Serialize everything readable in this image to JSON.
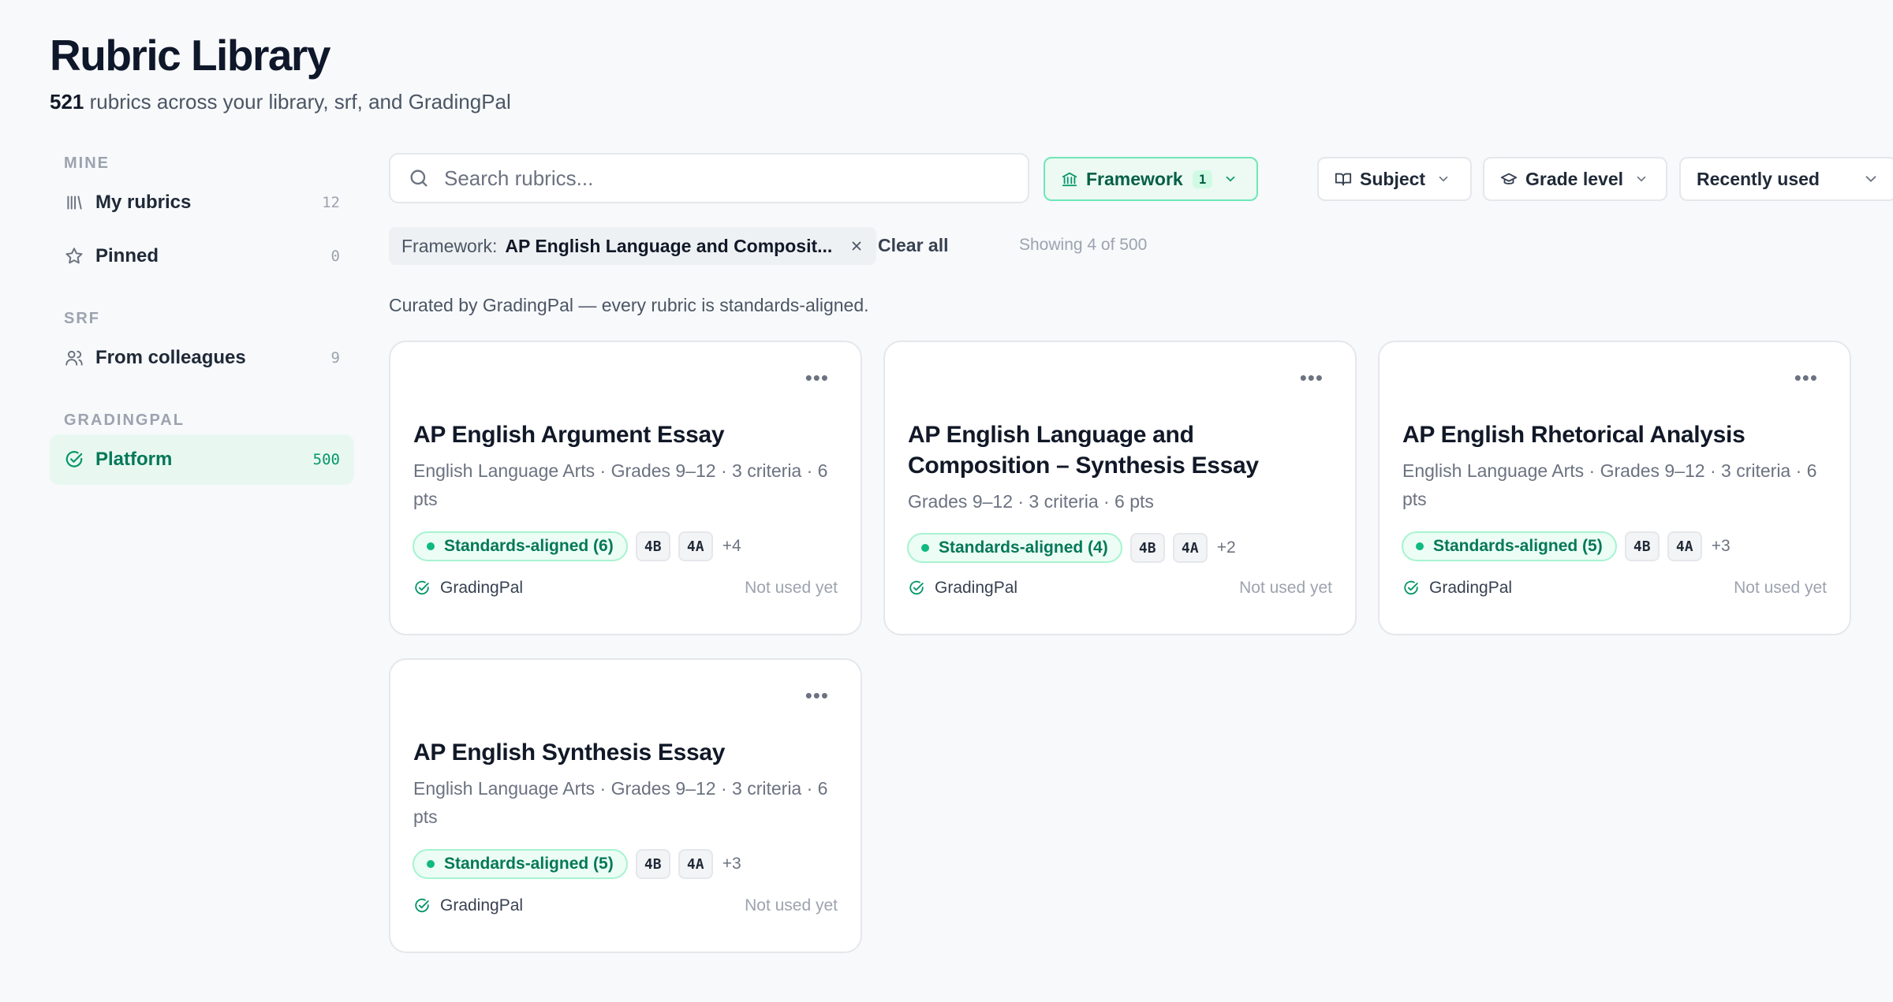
{
  "header": {
    "title": "Rubric Library",
    "count": "521",
    "subtitle_rest": "rubrics across your library, srf, and GradingPal"
  },
  "sidebar": {
    "sections": [
      {
        "label": "MINE",
        "items": [
          {
            "label": "My rubrics",
            "count": "12",
            "icon": "library-icon"
          },
          {
            "label": "Pinned",
            "count": "0",
            "icon": "star-icon"
          }
        ]
      },
      {
        "label": "SRF",
        "items": [
          {
            "label": "From colleagues",
            "count": "9",
            "icon": "users-icon"
          }
        ]
      },
      {
        "label": "GRADINGPAL",
        "items": [
          {
            "label": "Platform",
            "count": "500",
            "icon": "check-circle-icon",
            "active": true
          }
        ]
      }
    ]
  },
  "toolbar": {
    "search_placeholder": "Search rubrics...",
    "search_value": "",
    "framework_label": "Framework",
    "framework_count": "1",
    "subject_label": "Subject",
    "grade_label": "Grade level",
    "sort_label": "Recently used"
  },
  "filters": {
    "chip_key": "Framework:",
    "chip_value": "AP English Language and Composit...",
    "clear_all": "Clear all",
    "showing": "Showing 4 of 500"
  },
  "curated_note": "Curated by GradingPal — every rubric is standards-aligned.",
  "cards": [
    {
      "title": "AP English Argument Essay",
      "meta": "English Language Arts · Grades 9–12 · 3 criteria · 6 pts",
      "standards": "Standards-aligned (6)",
      "codes": [
        "4B",
        "4A"
      ],
      "more": "+4",
      "source": "GradingPal",
      "used": "Not used yet"
    },
    {
      "title": "AP English Language and Composition – Synthesis Essay",
      "meta": "Grades 9–12 · 3 criteria · 6 pts",
      "standards": "Standards-aligned (4)",
      "codes": [
        "4B",
        "4A"
      ],
      "more": "+2",
      "source": "GradingPal",
      "used": "Not used yet"
    },
    {
      "title": "AP English Rhetorical Analysis",
      "meta": "English Language Arts · Grades 9–12 · 3 criteria · 6 pts",
      "standards": "Standards-aligned (5)",
      "codes": [
        "4B",
        "4A"
      ],
      "more": "+3",
      "source": "GradingPal",
      "used": "Not used yet"
    },
    {
      "title": "AP English Synthesis Essay",
      "meta": "English Language Arts · Grades 9–12 · 3 criteria · 6 pts",
      "standards": "Standards-aligned (5)",
      "codes": [
        "4B",
        "4A"
      ],
      "more": "+3",
      "source": "GradingPal",
      "used": "Not used yet"
    }
  ],
  "colors": {
    "accent": "#059669",
    "accent_bg": "#ecfdf5",
    "background": "#f7f9fb"
  }
}
